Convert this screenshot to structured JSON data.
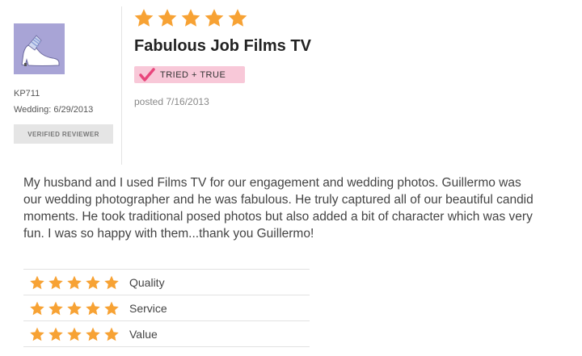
{
  "reviewer": {
    "username": "KP711",
    "wedding_date": "Wedding: 6/29/2013",
    "badge": "VERIFIED REVIEWER",
    "avatar_icon": "shoe-icon"
  },
  "review": {
    "overall_rating": 5,
    "max_rating": 5,
    "title": "Fabulous Job Films TV",
    "badge_label": "TRIED + TRUE",
    "posted": "posted 7/16/2013",
    "body": "My husband and I used Films TV for our engagement and wedding photos. Guillermo was our wedding photographer and he was fabulous. He truly captured all of our beautiful candid moments. He took traditional posed photos but also added a bit of character which was very fun. I was so happy with them...thank you Guillermo!"
  },
  "ratings": [
    {
      "label": "Quality",
      "value": 5
    },
    {
      "label": "Service",
      "value": 5
    },
    {
      "label": "Value",
      "value": 5
    }
  ],
  "colors": {
    "star": "#f7a234",
    "badge_pink": "#f8c8d8",
    "check": "#e8467c",
    "avatar_bg": "#a8a4d6"
  }
}
